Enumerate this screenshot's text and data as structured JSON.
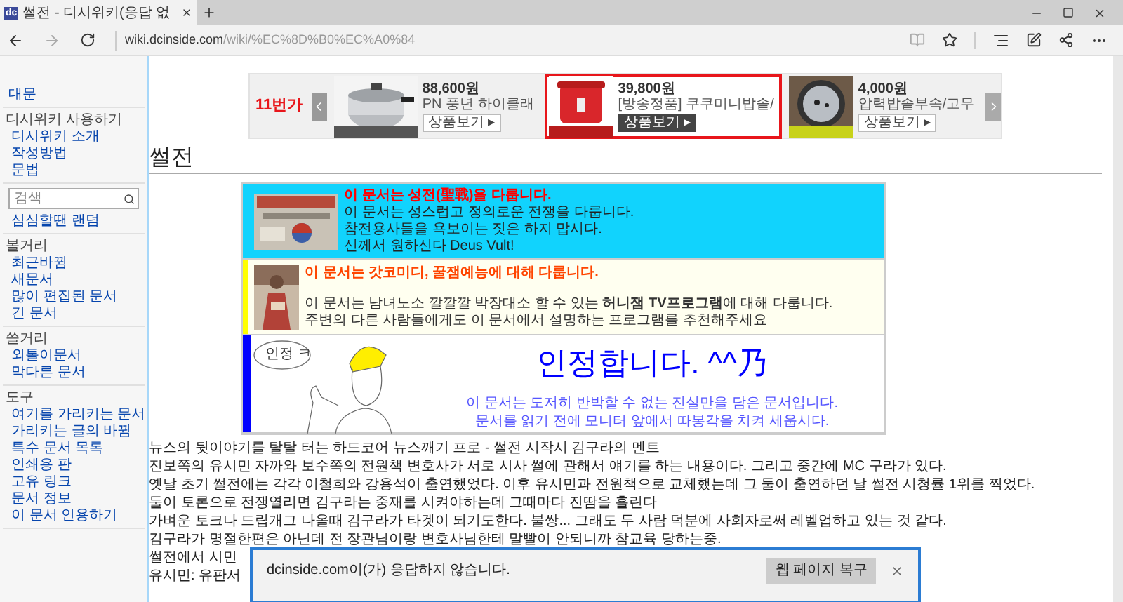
{
  "browser": {
    "tab": {
      "icon_text": "dc",
      "title": "썰전 - 디시위키(응답 없",
      "selected": true
    },
    "url_host": "wiki.dcinside.com",
    "url_path": "/wiki/%EC%8D%B0%EC%A0%84"
  },
  "sidebar": {
    "sections": [
      {
        "kind": "links",
        "links": [
          "대문"
        ]
      },
      {
        "kind": "links",
        "heading": "디시위키 사용하기",
        "links": [
          "디시위키 소개",
          "작성방법",
          "문법"
        ]
      },
      {
        "kind": "search",
        "placeholder": "검색"
      },
      {
        "kind": "links",
        "links": [
          "심심할땐 랜덤"
        ]
      },
      {
        "kind": "links",
        "heading": "볼거리",
        "links": [
          "최근바뀜",
          "새문서",
          "많이 편집된 문서",
          "긴 문서"
        ]
      },
      {
        "kind": "links",
        "heading": "쓸거리",
        "links": [
          "외톨이문서",
          "막다른 문서"
        ]
      },
      {
        "kind": "links",
        "heading": "도구",
        "links": [
          "여기를 가리키는 문서",
          "가리키는 글의 바뀜",
          "특수 문서 목록",
          "인쇄용 판",
          "고유 링크",
          "문서 정보",
          "이 문서 인용하기"
        ]
      }
    ]
  },
  "ad": {
    "logo": "11번가",
    "items": [
      {
        "price": "88,600원",
        "name": "PN 풍년 하이클래",
        "button": "상품보기 ▸",
        "highlighted": false
      },
      {
        "price": "39,800원",
        "name": "[방송정품] 쿠쿠미니밥솥/",
        "button": "상품보기 ▸",
        "highlighted": true
      },
      {
        "price": "4,000원",
        "name": "압력밥솥부속/고무",
        "button": "상품보기 ▸",
        "highlighted": false
      }
    ]
  },
  "page_title": "썰전",
  "notices": [
    {
      "kind": "holy",
      "title": "이 문서는 성전(聖戰)을 다룹니다.",
      "lines": [
        "이 문서는 성스럽고 정의로운 전쟁을 다룹니다.",
        "참전용사들을 욕보이는 짓은 하지 맙시다.",
        "신께서 원하신다 Deus Vult!"
      ]
    },
    {
      "kind": "comedy",
      "title": "이 문서는 갓코미디, 꿀잼예능에 대해 다룹니다.",
      "lines": [
        "이 문서는 남녀노소 깔깔깔 박장대소 할 수 있는 **허니잼 TV프로그램**에 대해 다룹니다.",
        "주변의 다른 사람들에게도 이 문서에서 설명하는 프로그램를 추천해주세요"
      ]
    },
    {
      "kind": "admit",
      "bubble": "인정 ㅋ",
      "title": "인정합니다. ^^乃",
      "lines": [
        "이 문서는 도저히 반박할 수 없는 진실만을 담은 문서입니다.",
        "문서를 읽기 전에 모니터 앞에서 따봉각을 치켜 세웁시다."
      ]
    }
  ],
  "paragraphs": [
    "뉴스의 뒷이야기를 탈탈 터는 하드코어 뉴스깨기 프로 - 썰전 시작시 김구라의 멘트",
    "진보쪽의 유시민 자까와 보수쪽의 전원책 변호사가 서로 시사 썰에 관해서 얘기를 하는 내용이다. 그리고 중간에 MC 구라가 있다.",
    "옛날 초기 썰전에는 각각 이철희와 강용석이 출연했었다. 이후 유시민과 전원책으로 교체했는데 그 둘이 출연하던 날 썰전 시청률 1위를 찍었다.",
    "둘이 토론으로 전쟁열리면 김구라는 중재를 시켜야하는데 그때마다 진땀을 흘린다",
    "가벼운 토크나 드립개그 나올때 김구라가 타겟이 되기도한다. 불쌍... 그래도 두 사람 덕분에 사회자로써 레벨업하고 있는 것 같다.",
    "김구라가 명절한편은 아닌데 전 장관님이랑 변호사님한테 말빨이 안되니까 참교육 당하는중.",
    "썰전에서 시민",
    "유시민: 유판서"
  ],
  "notification": {
    "message": "dcinside.com이(가) 응답하지 않습니다.",
    "button": "웹 페이지 복구"
  }
}
